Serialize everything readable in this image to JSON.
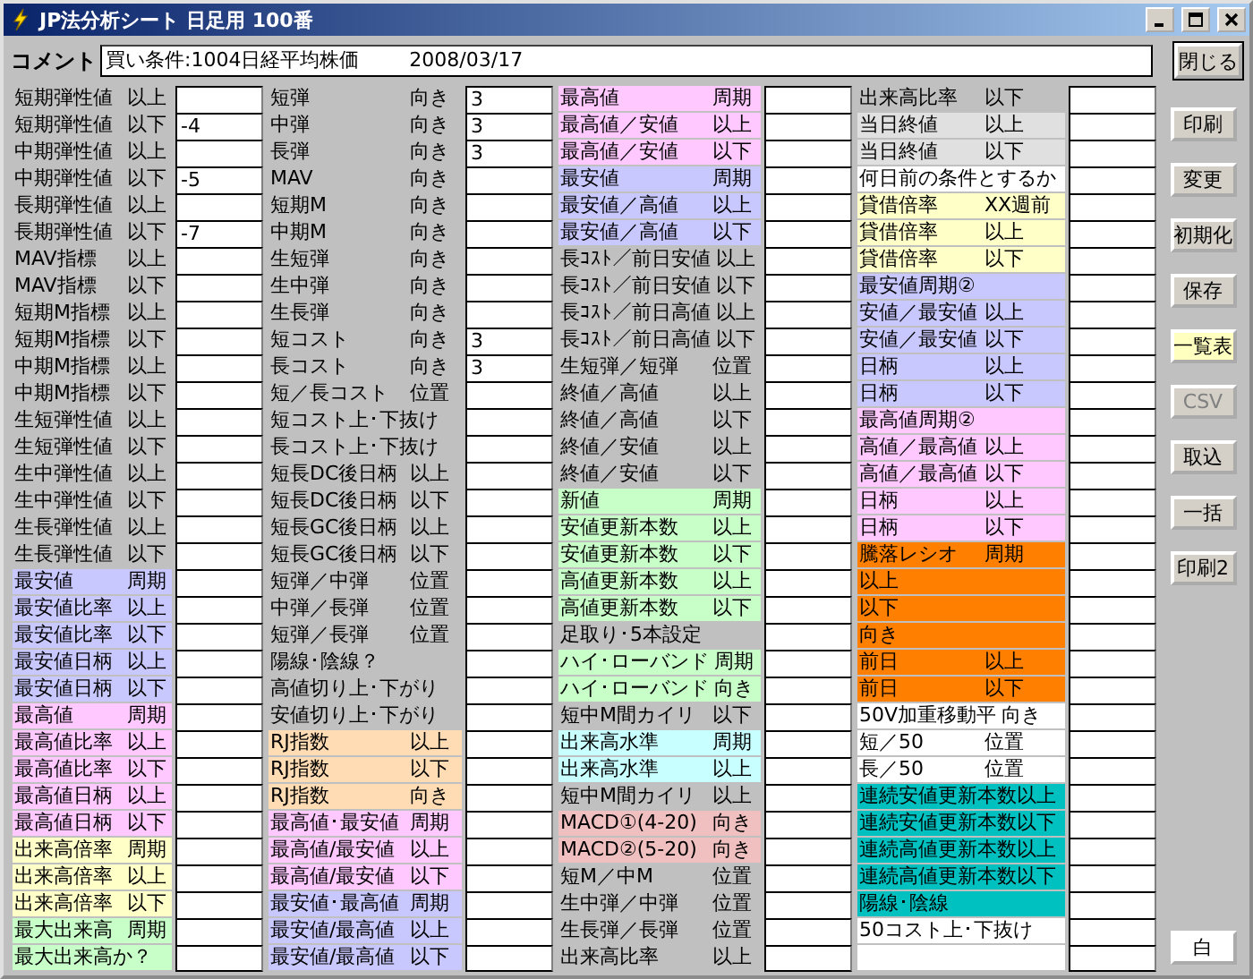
{
  "window": {
    "title": "JP法分析シート 日足用 100番"
  },
  "comment": {
    "label": "コメント",
    "value": "買い条件:1004日経平均株価        2008/03/17"
  },
  "close_button": {
    "label": "閉じる",
    "default": true
  },
  "columns": [
    {
      "rows": [
        {
          "name": "短期弾性値",
          "cond": "以上",
          "color": "#c0c0c0"
        },
        {
          "name": "短期弾性値",
          "cond": "以下",
          "color": "#c0c0c0",
          "value": "-4"
        },
        {
          "name": "中期弾性値",
          "cond": "以上",
          "color": "#c0c0c0"
        },
        {
          "name": "中期弾性値",
          "cond": "以下",
          "color": "#c0c0c0",
          "value": "-5"
        },
        {
          "name": "長期弾性値",
          "cond": "以上",
          "color": "#c0c0c0"
        },
        {
          "name": "長期弾性値",
          "cond": "以下",
          "color": "#c0c0c0",
          "value": "-7"
        },
        {
          "name": "MAV指標",
          "cond": "以上",
          "color": "#c0c0c0"
        },
        {
          "name": "MAV指標",
          "cond": "以下",
          "color": "#c0c0c0"
        },
        {
          "name": "短期M指標",
          "cond": "以上",
          "color": "#c0c0c0"
        },
        {
          "name": "短期M指標",
          "cond": "以下",
          "color": "#c0c0c0"
        },
        {
          "name": "中期M指標",
          "cond": "以上",
          "color": "#c0c0c0"
        },
        {
          "name": "中期M指標",
          "cond": "以下",
          "color": "#c0c0c0"
        },
        {
          "name": "生短弾性値",
          "cond": "以上",
          "color": "#c0c0c0"
        },
        {
          "name": "生短弾性値",
          "cond": "以下",
          "color": "#c0c0c0"
        },
        {
          "name": "生中弾性値",
          "cond": "以上",
          "color": "#c0c0c0"
        },
        {
          "name": "生中弾性値",
          "cond": "以下",
          "color": "#c0c0c0"
        },
        {
          "name": "生長弾性値",
          "cond": "以上",
          "color": "#c0c0c0"
        },
        {
          "name": "生長弾性値",
          "cond": "以下",
          "color": "#c0c0c0"
        },
        {
          "name": "最安値",
          "cond": "周期",
          "color": "#c8c8ff"
        },
        {
          "name": "最安値比率",
          "cond": "以上",
          "color": "#c8c8ff"
        },
        {
          "name": "最安値比率",
          "cond": "以下",
          "color": "#c8c8ff"
        },
        {
          "name": "最安値日柄",
          "cond": "以上",
          "color": "#c8c8ff"
        },
        {
          "name": "最安値日柄",
          "cond": "以下",
          "color": "#c8c8ff"
        },
        {
          "name": "最高値",
          "cond": "周期",
          "color": "#ffc8ff"
        },
        {
          "name": "最高値比率",
          "cond": "以上",
          "color": "#ffc8ff"
        },
        {
          "name": "最高値比率",
          "cond": "以下",
          "color": "#ffc8ff"
        },
        {
          "name": "最高値日柄",
          "cond": "以上",
          "color": "#ffc8ff"
        },
        {
          "name": "最高値日柄",
          "cond": "以下",
          "color": "#ffc8ff"
        },
        {
          "name": "出来高倍率",
          "cond": "周期",
          "color": "#ffffc8"
        },
        {
          "name": "出来高倍率",
          "cond": "以上",
          "color": "#ffffc8"
        },
        {
          "name": "出来高倍率",
          "cond": "以下",
          "color": "#ffffc8"
        },
        {
          "name": "最大出来高",
          "cond": "周期",
          "color": "#c8ffc8"
        },
        {
          "name": "最大出来高か？",
          "color": "#c8ffc8"
        }
      ]
    },
    {
      "rows": [
        {
          "name": "短弾",
          "cond": "向き",
          "color": "#c0c0c0",
          "value": "3"
        },
        {
          "name": "中弾",
          "cond": "向き",
          "color": "#c0c0c0",
          "value": "3"
        },
        {
          "name": "長弾",
          "cond": "向き",
          "color": "#c0c0c0",
          "value": "3"
        },
        {
          "name": "MAV",
          "cond": "向き",
          "color": "#c0c0c0"
        },
        {
          "name": "短期M",
          "cond": "向き",
          "color": "#c0c0c0"
        },
        {
          "name": "中期M",
          "cond": "向き",
          "color": "#c0c0c0"
        },
        {
          "name": "生短弾",
          "cond": "向き",
          "color": "#c0c0c0"
        },
        {
          "name": "生中弾",
          "cond": "向き",
          "color": "#c0c0c0"
        },
        {
          "name": "生長弾",
          "cond": "向き",
          "color": "#c0c0c0"
        },
        {
          "name": "短コスト",
          "cond": "向き",
          "color": "#c0c0c0",
          "value": "3"
        },
        {
          "name": "長コスト",
          "cond": "向き",
          "color": "#c0c0c0",
          "value": "3"
        },
        {
          "name": "短／長コスト",
          "cond": "位置",
          "color": "#c0c0c0"
        },
        {
          "name": "短コスト上･下抜け",
          "color": "#c0c0c0"
        },
        {
          "name": "長コスト上･下抜け",
          "color": "#c0c0c0"
        },
        {
          "name": "短長DC後日柄",
          "cond": "以上",
          "color": "#c0c0c0"
        },
        {
          "name": "短長DC後日柄",
          "cond": "以下",
          "color": "#c0c0c0"
        },
        {
          "name": "短長GC後日柄",
          "cond": "以上",
          "color": "#c0c0c0"
        },
        {
          "name": "短長GC後日柄",
          "cond": "以下",
          "color": "#c0c0c0"
        },
        {
          "name": "短弾／中弾",
          "cond": "位置",
          "color": "#c0c0c0"
        },
        {
          "name": "中弾／長弾",
          "cond": "位置",
          "color": "#c0c0c0"
        },
        {
          "name": "短弾／長弾",
          "cond": "位置",
          "color": "#c0c0c0"
        },
        {
          "name": "陽線･陰線？",
          "color": "#c0c0c0"
        },
        {
          "name": "高値切り上･下がり",
          "color": "#c0c0c0"
        },
        {
          "name": "安値切り上･下がり",
          "color": "#c0c0c0"
        },
        {
          "name": "RJ指数",
          "cond": "以上",
          "color": "#ffdcb4"
        },
        {
          "name": "RJ指数",
          "cond": "以下",
          "color": "#ffdcb4"
        },
        {
          "name": "RJ指数",
          "cond": "向き",
          "color": "#ffdcb4"
        },
        {
          "name": "最高値･最安値",
          "cond": "周期",
          "color": "#ffc8ff"
        },
        {
          "name": "最高値/最安値",
          "cond": "以上",
          "color": "#ffc8ff"
        },
        {
          "name": "最高値/最安値",
          "cond": "以下",
          "color": "#ffc8ff"
        },
        {
          "name": "最安値･最高値",
          "cond": "周期",
          "color": "#c8c8ff"
        },
        {
          "name": "最安値/最高値",
          "cond": "以上",
          "color": "#c8c8ff"
        },
        {
          "name": "最安値/最高値",
          "cond": "以下",
          "color": "#c8c8ff"
        }
      ]
    },
    {
      "rows": [
        {
          "name": "最高値",
          "cond": "周期",
          "color": "#ffc8ff"
        },
        {
          "name": "最高値／安値",
          "cond": "以上",
          "color": "#ffc8ff"
        },
        {
          "name": "最高値／安値",
          "cond": "以下",
          "color": "#ffc8ff"
        },
        {
          "name": "最安値",
          "cond": "周期",
          "color": "#c8c8ff"
        },
        {
          "name": "最安値／高値",
          "cond": "以上",
          "color": "#c8c8ff"
        },
        {
          "name": "最安値／高値",
          "cond": "以下",
          "color": "#c8c8ff"
        },
        {
          "name": "長ｺｽﾄ／前日安値",
          "cond": "以上",
          "color": "#c0c0c0"
        },
        {
          "name": "長ｺｽﾄ／前日安値",
          "cond": "以下",
          "color": "#c0c0c0"
        },
        {
          "name": "長ｺｽﾄ／前日高値",
          "cond": "以上",
          "color": "#c0c0c0"
        },
        {
          "name": "長ｺｽﾄ／前日高値",
          "cond": "以下",
          "color": "#c0c0c0"
        },
        {
          "name": "生短弾／短弾",
          "cond": "位置",
          "color": "#c0c0c0"
        },
        {
          "name": "終値／高値",
          "cond": "以上",
          "color": "#c0c0c0"
        },
        {
          "name": "終値／高値",
          "cond": "以下",
          "color": "#c0c0c0"
        },
        {
          "name": "終値／安値",
          "cond": "以上",
          "color": "#c0c0c0"
        },
        {
          "name": "終値／安値",
          "cond": "以下",
          "color": "#c0c0c0"
        },
        {
          "name": "新値",
          "cond": "周期",
          "color": "#c8ffc8"
        },
        {
          "name": "安値更新本数",
          "cond": "以上",
          "color": "#c8ffc8"
        },
        {
          "name": "安値更新本数",
          "cond": "以下",
          "color": "#c8ffc8"
        },
        {
          "name": "高値更新本数",
          "cond": "以上",
          "color": "#c8ffc8"
        },
        {
          "name": "高値更新本数",
          "cond": "以下",
          "color": "#c8ffc8"
        },
        {
          "name": "足取り･5本設定",
          "color": "#c0c0c0"
        },
        {
          "name": "ハイ･ローバンド",
          "cond": "周期",
          "color": "#c8ffc8"
        },
        {
          "name": "ハイ･ローバンド",
          "cond": "向き",
          "color": "#c8ffc8"
        },
        {
          "name": "短中M間カイリ",
          "cond": "以下",
          "color": "#c0c0c0"
        },
        {
          "name": "出来高水準",
          "cond": "周期",
          "color": "#c8ffff"
        },
        {
          "name": "出来高水準",
          "cond": "以上",
          "color": "#c8ffff"
        },
        {
          "name": "短中M間カイリ",
          "cond": "以上",
          "color": "#c0c0c0"
        },
        {
          "name": "MACD①(4-20)",
          "cond": "向き",
          "color": "#f0c0c0"
        },
        {
          "name": "MACD②(5-20)",
          "cond": "向き",
          "color": "#f0c0c0"
        },
        {
          "name": "短M／中M",
          "cond": "位置",
          "color": "#c0c0c0"
        },
        {
          "name": "生中弾／中弾",
          "cond": "位置",
          "color": "#c0c0c0"
        },
        {
          "name": "生長弾／長弾",
          "cond": "位置",
          "color": "#c0c0c0"
        },
        {
          "name": "出来高比率",
          "cond": "以上",
          "color": "#c0c0c0"
        }
      ]
    },
    {
      "rows": [
        {
          "name": "出来高比率",
          "cond": "以下",
          "color": "#c0c0c0"
        },
        {
          "name": "当日終値",
          "cond": "以上",
          "color": "#e0e0e0"
        },
        {
          "name": "当日終値",
          "cond": "以下",
          "color": "#e0e0e0"
        },
        {
          "name": "何日前の条件とするか",
          "color": "#ffffff"
        },
        {
          "name": "貸借倍率",
          "cond": "XX週前",
          "color": "#ffffc8"
        },
        {
          "name": "貸借倍率",
          "cond": "以上",
          "color": "#ffffc8"
        },
        {
          "name": "貸借倍率",
          "cond": "以下",
          "color": "#ffffc8"
        },
        {
          "name": "最安値周期②",
          "color": "#c8c8ff"
        },
        {
          "name": "安値／最安値",
          "cond": "以上",
          "color": "#c8c8ff"
        },
        {
          "name": "安値／最安値",
          "cond": "以下",
          "color": "#c8c8ff"
        },
        {
          "name": "日柄",
          "cond": "以上",
          "color": "#c8c8ff"
        },
        {
          "name": "日柄",
          "cond": "以下",
          "color": "#c8c8ff"
        },
        {
          "name": "最高値周期②",
          "color": "#ffc8ff"
        },
        {
          "name": "高値／最高値",
          "cond": "以上",
          "color": "#ffc8ff"
        },
        {
          "name": "高値／最高値",
          "cond": "以下",
          "color": "#ffc8ff"
        },
        {
          "name": "日柄",
          "cond": "以上",
          "color": "#ffc8ff"
        },
        {
          "name": "日柄",
          "cond": "以下",
          "color": "#ffc8ff"
        },
        {
          "name": "騰落レシオ",
          "cond": "周期",
          "color": "#ff8000"
        },
        {
          "name": "以上",
          "color": "#ff8000"
        },
        {
          "name": "以下",
          "color": "#ff8000"
        },
        {
          "name": "向き",
          "color": "#ff8000"
        },
        {
          "name": "前日",
          "cond": "以上",
          "color": "#ff8000"
        },
        {
          "name": "前日",
          "cond": "以下",
          "color": "#ff8000"
        },
        {
          "name": "50V加重移動平",
          "cond": "向き",
          "color": "#ffffff"
        },
        {
          "name": "短／50",
          "cond": "位置",
          "color": "#ffffff"
        },
        {
          "name": "長／50",
          "cond": "位置",
          "color": "#ffffff"
        },
        {
          "name": "連続安値更新本数以上",
          "color": "#00c0c0"
        },
        {
          "name": "連続安値更新本数以下",
          "color": "#00c0c0"
        },
        {
          "name": "連続高値更新本数以上",
          "color": "#00c0c0"
        },
        {
          "name": "連続高値更新本数以下",
          "color": "#00c0c0"
        },
        {
          "name": "陽線･陰線",
          "color": "#00c0c0"
        },
        {
          "name": "50コスト上･下抜け",
          "color": "#ffffff"
        },
        {
          "color": "#ffffff"
        }
      ]
    }
  ],
  "buttons": [
    {
      "label": "印刷",
      "color": "#d4d0c8",
      "disabled": false
    },
    {
      "label": "変更",
      "color": "#d4d0c8",
      "disabled": false
    },
    {
      "label": "初期化",
      "color": "#d4d0c8",
      "disabled": false
    },
    {
      "label": "保存",
      "color": "#d4d0c8",
      "disabled": false
    },
    {
      "label": "一覧表",
      "color": "#ffffc0",
      "disabled": false
    },
    {
      "label": "CSV",
      "color": "#d4d0c8",
      "disabled": true
    },
    {
      "label": "取込",
      "color": "#d4d0c8",
      "disabled": false
    },
    {
      "label": "一括",
      "color": "#d4d0c8",
      "disabled": false
    },
    {
      "label": "印刷2",
      "color": "#d4d0c8",
      "disabled": false
    }
  ],
  "bottom_button": {
    "label": "白",
    "color": "#ffffff",
    "disabled": false
  }
}
